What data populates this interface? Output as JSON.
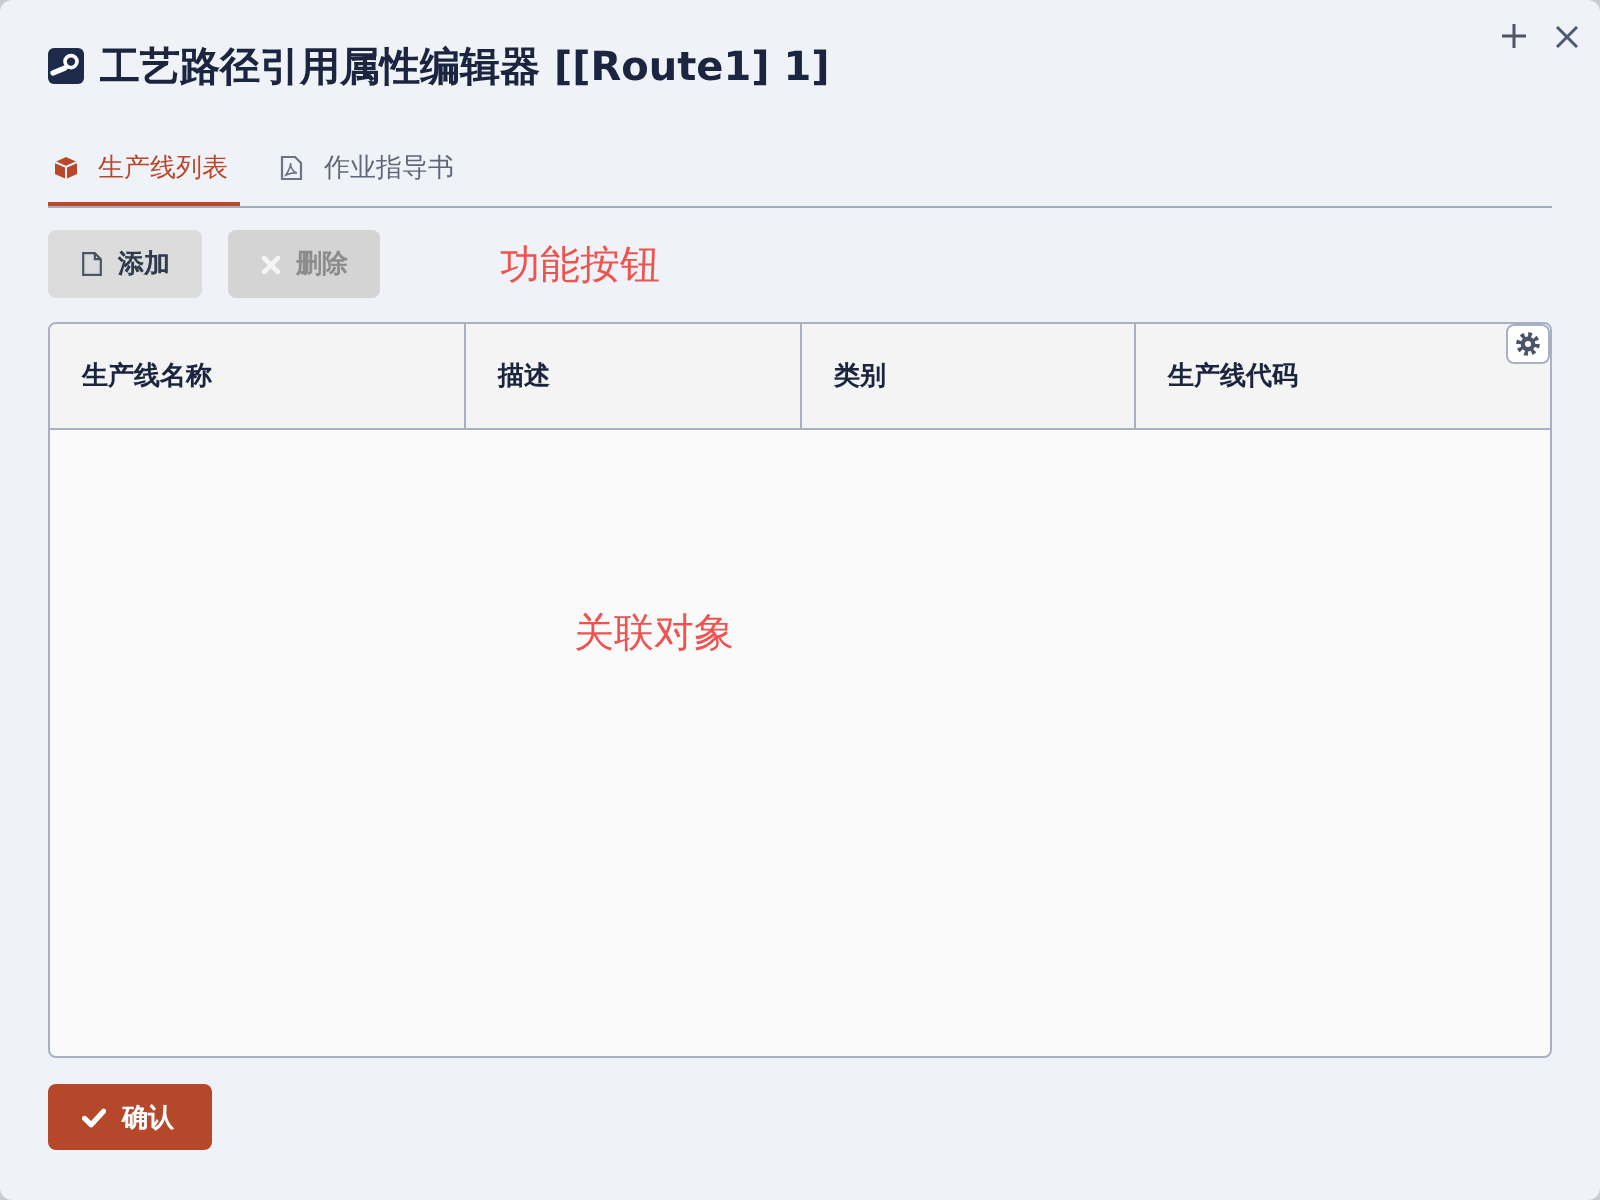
{
  "window": {
    "title": "工艺路径引用属性编辑器 [[Route1] 1]"
  },
  "tabs": [
    {
      "label": "生产线列表",
      "selected": true
    },
    {
      "label": "作业指导书",
      "selected": false
    }
  ],
  "toolbar": {
    "buttons": [
      {
        "label": "添加",
        "disabled": false
      },
      {
        "label": "删除",
        "disabled": true
      }
    ],
    "annotation": "功能按钮"
  },
  "table": {
    "columns": [
      "生产线名称",
      "描述",
      "类别",
      "生产线代码"
    ],
    "annotation": "关联对象"
  },
  "confirm_button": {
    "label": "确认"
  }
}
